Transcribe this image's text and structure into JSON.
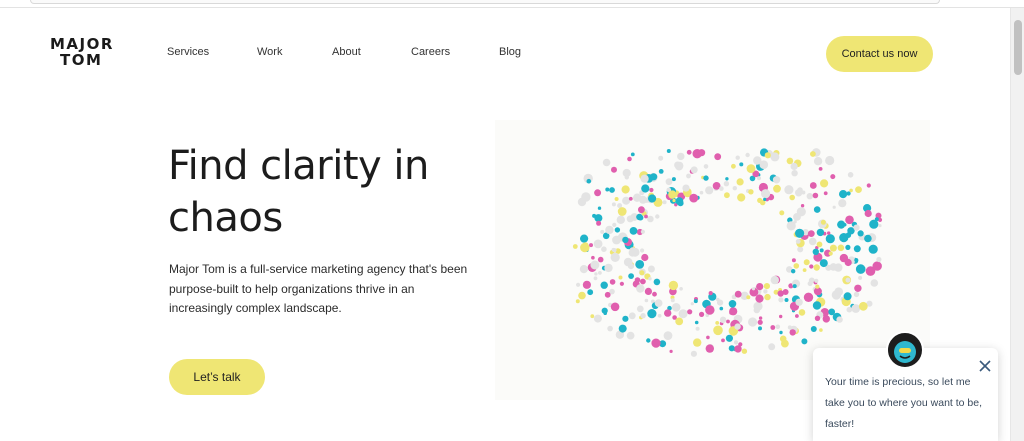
{
  "brand": {
    "line1": "MAJOR",
    "line2": "TOM"
  },
  "nav": {
    "items": [
      {
        "label": "Services"
      },
      {
        "label": "Work"
      },
      {
        "label": "About"
      },
      {
        "label": "Careers"
      },
      {
        "label": "Blog"
      }
    ],
    "cta_label": "Contact us now"
  },
  "hero": {
    "title": "Find clarity in chaos",
    "description": "Major Tom is a full-service marketing agency that's been purpose-built to help organizations thrive in an increasingly complex landscape.",
    "button_label": "Let’s talk"
  },
  "chat": {
    "message": "Your time is precious, so let me take you to where you want to be, faster!",
    "close_icon": "close-icon",
    "avatar_icon": "robot-avatar-icon"
  },
  "colors": {
    "accent_yellow": "#efe674",
    "dot_pink": "#e05fae",
    "dot_cyan": "#1fb3c9",
    "dot_yellow": "#efe674",
    "dot_grey": "#e3e3e3"
  }
}
